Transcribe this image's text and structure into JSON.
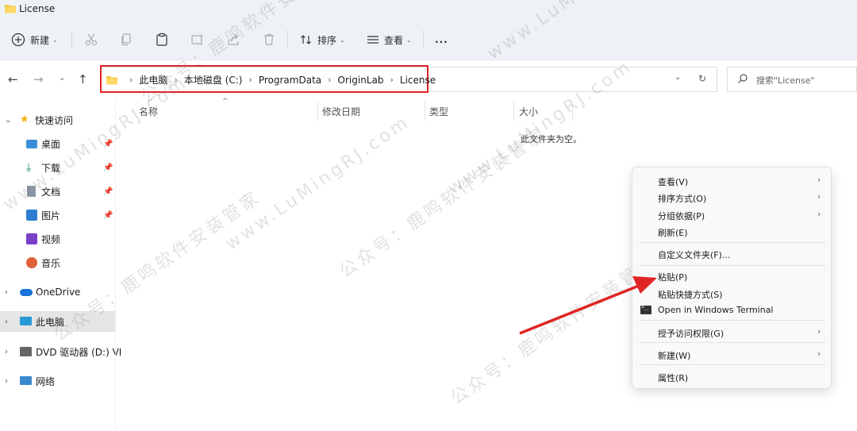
{
  "window": {
    "title": "License"
  },
  "toolbar": {
    "new_label": "新建",
    "sort_label": "排序",
    "view_label": "查看",
    "more_label": "..."
  },
  "address": {
    "crumbs": [
      "此电脑",
      "本地磁盘 (C:)",
      "ProgramData",
      "OriginLab",
      "License"
    ],
    "highlight_color": "#e02424"
  },
  "search": {
    "placeholder": "搜索\"License\""
  },
  "sidebar": {
    "quick_access": "快速访问",
    "items": [
      {
        "label": "桌面",
        "icon": "desktop-icon",
        "pinned": true
      },
      {
        "label": "下载",
        "icon": "download-icon",
        "pinned": true
      },
      {
        "label": "文档",
        "icon": "document-icon",
        "pinned": true
      },
      {
        "label": "图片",
        "icon": "picture-icon",
        "pinned": true
      },
      {
        "label": "视频",
        "icon": "video-icon",
        "pinned": false
      },
      {
        "label": "音乐",
        "icon": "music-icon",
        "pinned": false
      }
    ],
    "onedrive": "OneDrive",
    "this_pc": "此电脑",
    "dvd": "DVD 驱动器 (D:) VI",
    "network": "网络"
  },
  "columns": [
    "名称",
    "修改日期",
    "类型",
    "大小"
  ],
  "empty_message": "此文件夹为空。",
  "context_menu": {
    "items": [
      {
        "label": "查看(V)",
        "submenu": true
      },
      {
        "label": "排序方式(O)",
        "submenu": true
      },
      {
        "label": "分组依据(P)",
        "submenu": true
      },
      {
        "label": "刷新(E)",
        "submenu": false
      },
      {
        "label": "自定义文件夹(F)...",
        "submenu": false
      },
      {
        "label": "粘贴(P)",
        "submenu": false
      },
      {
        "label": "粘贴快捷方式(S)",
        "submenu": false
      },
      {
        "label": "Open in Windows Terminal",
        "submenu": false
      },
      {
        "label": "授予访问权限(G)",
        "submenu": true
      },
      {
        "label": "新建(W)",
        "submenu": true
      },
      {
        "label": "属性(R)",
        "submenu": false
      }
    ]
  },
  "watermark": {
    "text_cn": "公众号：鹿鸣软件安装管家",
    "text_url": "www.LuMingRJ.com"
  },
  "colors": {
    "chrome_bg": "#eef2f7",
    "accent_red": "#e02424",
    "folder_yellow": "#f4c542"
  }
}
